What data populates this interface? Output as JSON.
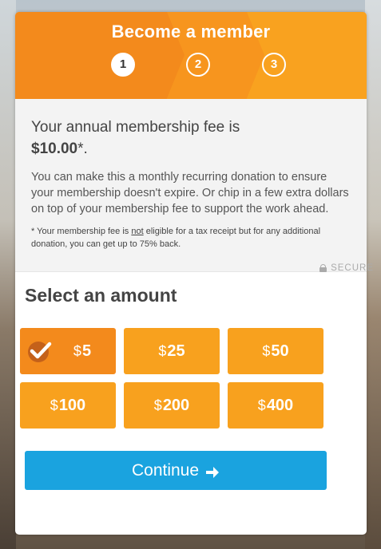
{
  "header": {
    "title": "Become a member",
    "steps": [
      "1",
      "2",
      "3"
    ],
    "active_step": 1
  },
  "info": {
    "fee_prefix": "Your annual membership fee is",
    "fee_amount": "$10.00",
    "fee_suffix": "*.",
    "description": "You can make this a monthly recurring donation to ensure your membership doesn't expire. Or chip in a few extra dollars on top of your membership fee to support the work ahead.",
    "note_before": "* Your membership fee is ",
    "note_not": "not",
    "note_after": " eligible for a tax receipt but for any additional donation, you can get up to 75% back."
  },
  "secure_label": "SECURE",
  "amount_section": {
    "title": "Select an amount",
    "currency_symbol": "$",
    "options": [
      "5",
      "25",
      "50",
      "100",
      "200",
      "400"
    ],
    "selected": "5"
  },
  "continue_button": {
    "label": "Continue"
  },
  "colors": {
    "orange": "#f8a11e",
    "orange_selected": "#f38a1c",
    "blue": "#1aa3df"
  },
  "icons": {
    "check": "check-icon",
    "lock": "lock-icon",
    "arrow": "arrow-right-icon"
  }
}
